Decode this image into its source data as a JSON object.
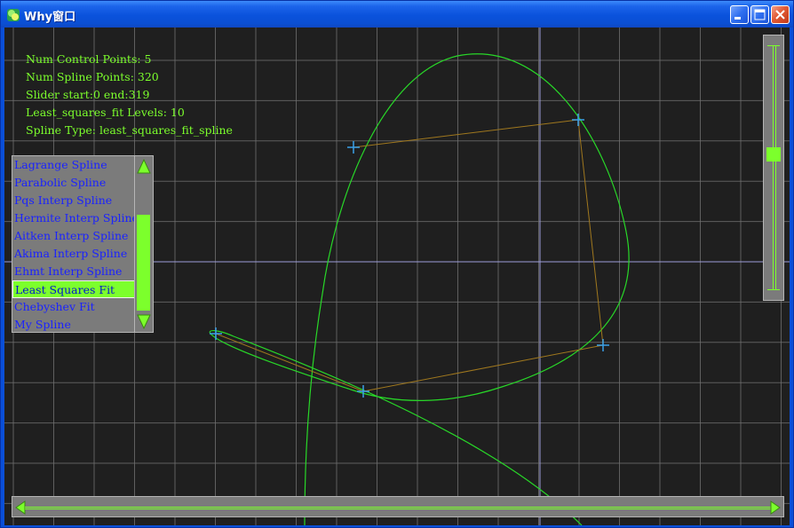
{
  "window": {
    "title": "Why窗口",
    "controls": [
      "minimize",
      "maximize",
      "close"
    ],
    "icons": {
      "app": "spline-app-icon"
    }
  },
  "info": {
    "num_control_points": "Num Control Points: 5",
    "num_spline_points": "Num Spline Points: 320",
    "slider_range": "Slider start:0 end:319",
    "levels": "Least_squares_fit Levels: 10",
    "spline_type": "Spline Type: least_squares_fit_spline"
  },
  "spline_list": {
    "items": [
      "Lagrange Spline",
      "Parabolic Spline",
      "Pqs Interp Spline",
      "Hermite Interp Spline",
      "Aitken Interp Spline",
      "Akima Interp Spline",
      "Ehmt Interp Spline",
      "Least Squares Fit",
      "Chebyshev Fit",
      "My Spline"
    ],
    "selected": "Least Squares Fit"
  },
  "control_points": [
    [
      393,
      135
    ],
    [
      646,
      104
    ],
    [
      674,
      358
    ],
    [
      404,
      410
    ],
    [
      238,
      345
    ]
  ],
  "colors": {
    "background": "#1f1f1f",
    "grid": "#6f6f6f",
    "axis": "#9c9cd8",
    "curve": "#28d828",
    "control_polygon": "#a0781e",
    "control_marker": "#3aa0e8",
    "text": "#7cff2c",
    "list_text": "#1a22ff",
    "accent": "#7cff2c",
    "panel": "#7b7b7b"
  }
}
